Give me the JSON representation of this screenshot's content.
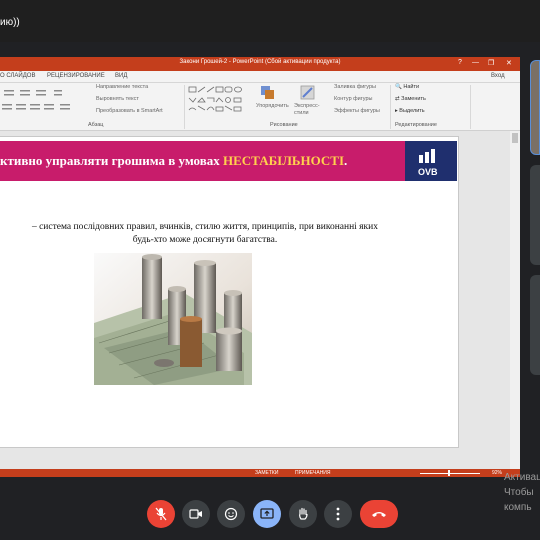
{
  "meeting": {
    "title_fragment": "ию))"
  },
  "ppt": {
    "window_title": "Закони Грошей-2 - PowerPoint (Сбой активации продукта)",
    "title_help": "?",
    "login": "Вход",
    "menu": [
      "О СЛАЙДОВ",
      "РЕЦЕНЗИРОВАНИЕ",
      "ВИД"
    ],
    "ribbon": {
      "paragraph": {
        "text_direction": "Направление текста",
        "align_text": "Выровнять текст",
        "smartart": "Преобразовать в SmartArt",
        "group_label": "Абзац"
      },
      "drawing": {
        "arrange": "Упорядочить",
        "quick_styles": "Экспресс-стили",
        "shape_fill": "Заливка фигуры",
        "shape_outline": "Контур фигуры",
        "shape_effects": "Эффекты фигуры",
        "group_label": "Рисование"
      },
      "editing": {
        "find": "Найти",
        "replace": "Заменить",
        "select": "Выделить",
        "group_label": "Редактирование"
      }
    },
    "slide": {
      "heading_main": "ктивно  управляти грошима в умовах ",
      "heading_highlight": "НЕСТАБІЛЬНОСТІ",
      "heading_end": ".",
      "logo_text": "OVB",
      "body_line1": "– система послідовних правил, вчинків, стилю життя, принципів, при виконанні яких",
      "body_line2": "будь-хто може досягнути багатства."
    },
    "status": {
      "notes": "ЗАМЕТКИ",
      "comments": "ПРИМЕЧАНИЯ",
      "zoom": "92%"
    }
  },
  "watermark": {
    "line1": "Активация",
    "line2": "Чтобы",
    "line3": "компь"
  },
  "colors": {
    "ppt_accent": "#c43e1c",
    "banner": "#c81c6b",
    "highlight": "#ffd24d",
    "logo_bg": "#1f2f6e",
    "end_call": "#ea4335",
    "present": "#8ab4f8"
  },
  "controls": [
    "mic-off-icon",
    "camera-icon",
    "emoji-icon",
    "present-icon",
    "raise-hand-icon",
    "more-options-icon",
    "end-call-icon"
  ]
}
